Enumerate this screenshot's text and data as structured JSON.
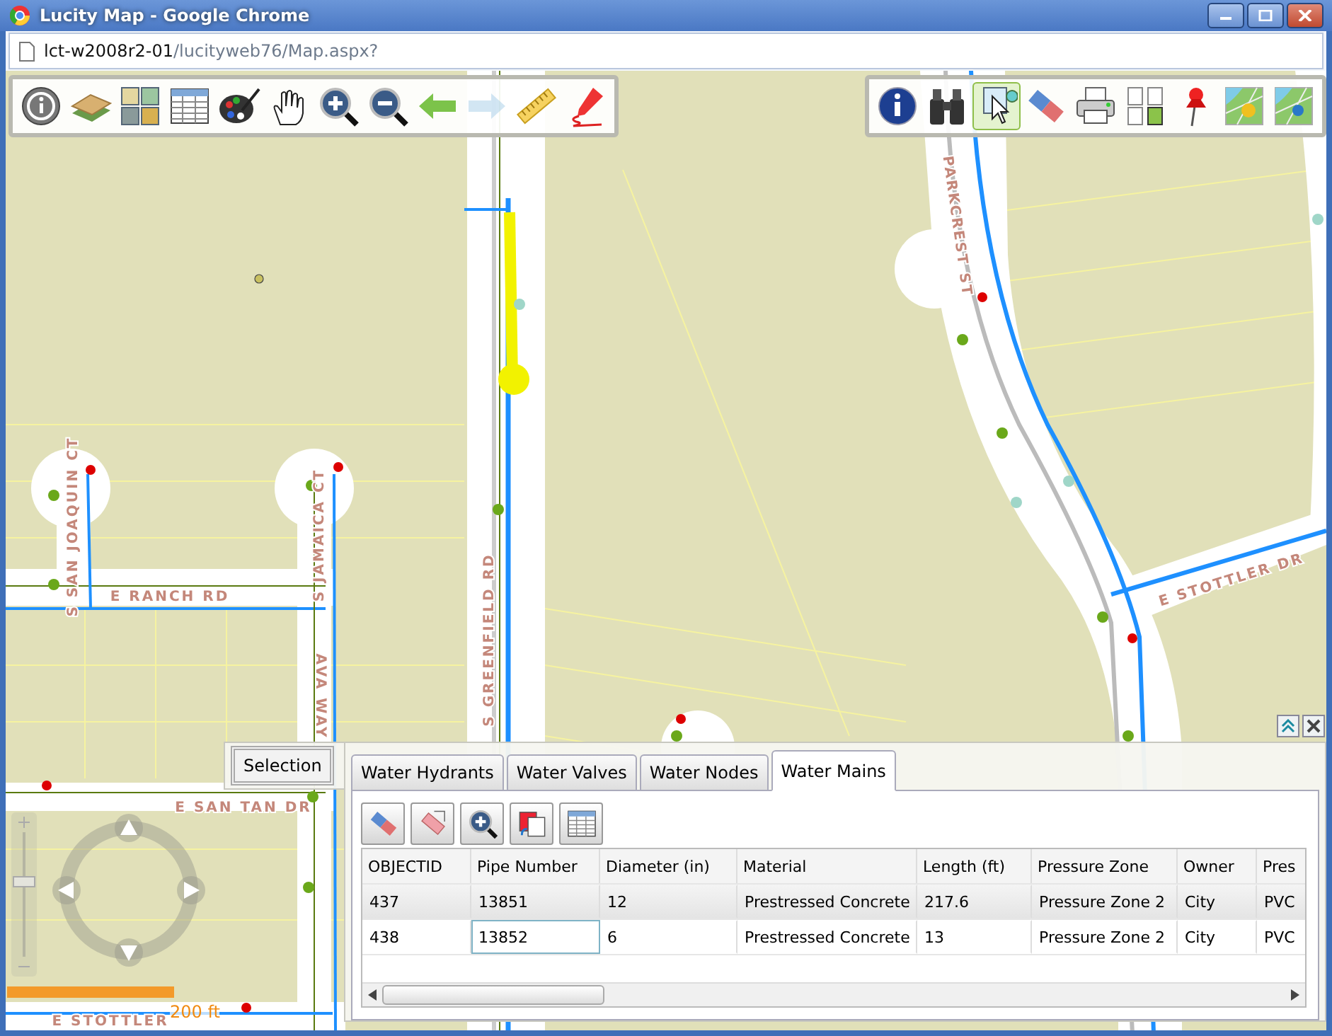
{
  "window": {
    "title": "Lucity Map - Google Chrome"
  },
  "address_bar": {
    "host": "lct-w2008r2-01",
    "path": "/lucityweb76/Map.aspx?"
  },
  "left_toolbar": [
    {
      "kind": "info",
      "disabled": false
    },
    {
      "kind": "layers",
      "disabled": false
    },
    {
      "kind": "basemaps",
      "disabled": false
    },
    {
      "kind": "table",
      "disabled": false
    },
    {
      "kind": "palette",
      "disabled": false
    },
    {
      "kind": "pan",
      "disabled": false
    },
    {
      "kind": "zoom-in",
      "disabled": false
    },
    {
      "kind": "zoom-out",
      "disabled": false
    },
    {
      "kind": "back",
      "disabled": false
    },
    {
      "kind": "forward",
      "disabled": true
    },
    {
      "kind": "ruler",
      "disabled": false
    },
    {
      "kind": "draw",
      "disabled": false
    }
  ],
  "right_toolbar": [
    {
      "kind": "identify",
      "selected": false
    },
    {
      "kind": "find",
      "selected": false
    },
    {
      "kind": "select",
      "selected": true
    },
    {
      "kind": "eraser",
      "selected": false
    },
    {
      "kind": "print",
      "selected": false
    },
    {
      "kind": "pages",
      "selected": false
    },
    {
      "kind": "pushpin",
      "selected": false
    },
    {
      "kind": "map-hydrant",
      "selected": false
    },
    {
      "kind": "map-valve",
      "selected": false
    }
  ],
  "map": {
    "street_labels": [
      "S SAN JOAQUIN CT",
      "E RANCH RD",
      "S JAMAICA CT",
      "AVA WAY",
      "S GREENFIELD RD",
      "PARKCREST ST",
      "E STOTTLER DR",
      "E SAN TAN DR",
      "E STOTTLER"
    ],
    "zoom_slider": {
      "level": 0.6
    },
    "scale": {
      "label": "200 ft"
    }
  },
  "results_panel": {
    "selection_button": "Selection",
    "tabs": [
      {
        "label": "Water Hydrants",
        "selected": false
      },
      {
        "label": "Water Valves",
        "selected": false
      },
      {
        "label": "Water Nodes",
        "selected": false
      },
      {
        "label": "Water Mains",
        "selected": true
      }
    ],
    "tools": [
      {
        "kind": "eraser"
      },
      {
        "kind": "clear-selection"
      },
      {
        "kind": "zoom-to"
      },
      {
        "kind": "switch"
      },
      {
        "kind": "table-view"
      }
    ],
    "table": {
      "columns": [
        "OBJECTID",
        "Pipe Number",
        "Diameter (in)",
        "Material",
        "Length (ft)",
        "Pressure Zone",
        "Owner",
        "Pres"
      ],
      "rows": [
        {
          "selected": true,
          "cells": [
            {
              "text": "437",
              "focused": false
            },
            {
              "text": "13851",
              "focused": false
            },
            {
              "text": "12",
              "focused": false
            },
            {
              "text": "Prestressed Concrete",
              "focused": false
            },
            {
              "text": "217.6",
              "focused": false
            },
            {
              "text": "Pressure Zone 2",
              "focused": false
            },
            {
              "text": "City",
              "focused": false
            },
            {
              "text": "PVC",
              "focused": false
            }
          ]
        },
        {
          "selected": false,
          "cells": [
            {
              "text": "438",
              "focused": false
            },
            {
              "text": "13852",
              "focused": true
            },
            {
              "text": "6",
              "focused": false
            },
            {
              "text": "Prestressed Concrete",
              "focused": false
            },
            {
              "text": "13",
              "focused": false
            },
            {
              "text": "Pressure Zone 2",
              "focused": false
            },
            {
              "text": "City",
              "focused": false
            },
            {
              "text": "PVC",
              "focused": false
            }
          ]
        }
      ]
    }
  }
}
